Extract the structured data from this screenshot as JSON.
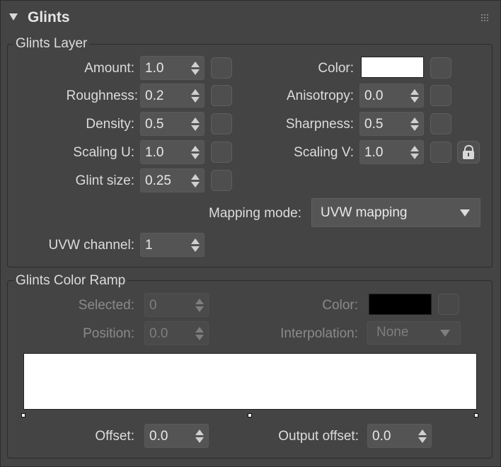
{
  "rollout": {
    "title": "Glints"
  },
  "glints_layer": {
    "group_title": "Glints Layer",
    "amount": {
      "label": "Amount:",
      "value": "1.0"
    },
    "roughness": {
      "label": "Roughness:",
      "value": "0.2"
    },
    "density": {
      "label": "Density:",
      "value": "0.5"
    },
    "scaling_u": {
      "label": "Scaling U:",
      "value": "1.0"
    },
    "glint_size": {
      "label": "Glint size:",
      "value": "0.25"
    },
    "color": {
      "label": "Color:",
      "swatch": "#ffffff"
    },
    "anisotropy": {
      "label": "Anisotropy:",
      "value": "0.0"
    },
    "sharpness": {
      "label": "Sharpness:",
      "value": "0.5"
    },
    "scaling_v": {
      "label": "Scaling V:",
      "value": "1.0"
    },
    "mapping_mode": {
      "label": "Mapping mode:",
      "value": "UVW mapping"
    },
    "uvw_channel": {
      "label": "UVW channel:",
      "value": "1"
    }
  },
  "color_ramp": {
    "group_title": "Glints Color Ramp",
    "selected": {
      "label": "Selected:",
      "value": "0"
    },
    "position": {
      "label": "Position:",
      "value": "0.0"
    },
    "color": {
      "label": "Color:",
      "swatch": "#000000"
    },
    "interpolation": {
      "label": "Interpolation:",
      "value": "None"
    },
    "ramp_color": "#ffffff",
    "offset": {
      "label": "Offset:",
      "value": "0.0"
    },
    "output_offset": {
      "label": "Output offset:",
      "value": "0.0"
    }
  },
  "icons": {
    "collapse": "triangle-down-icon",
    "grip": "grip-dots-icon",
    "lock": "lock-icon"
  }
}
